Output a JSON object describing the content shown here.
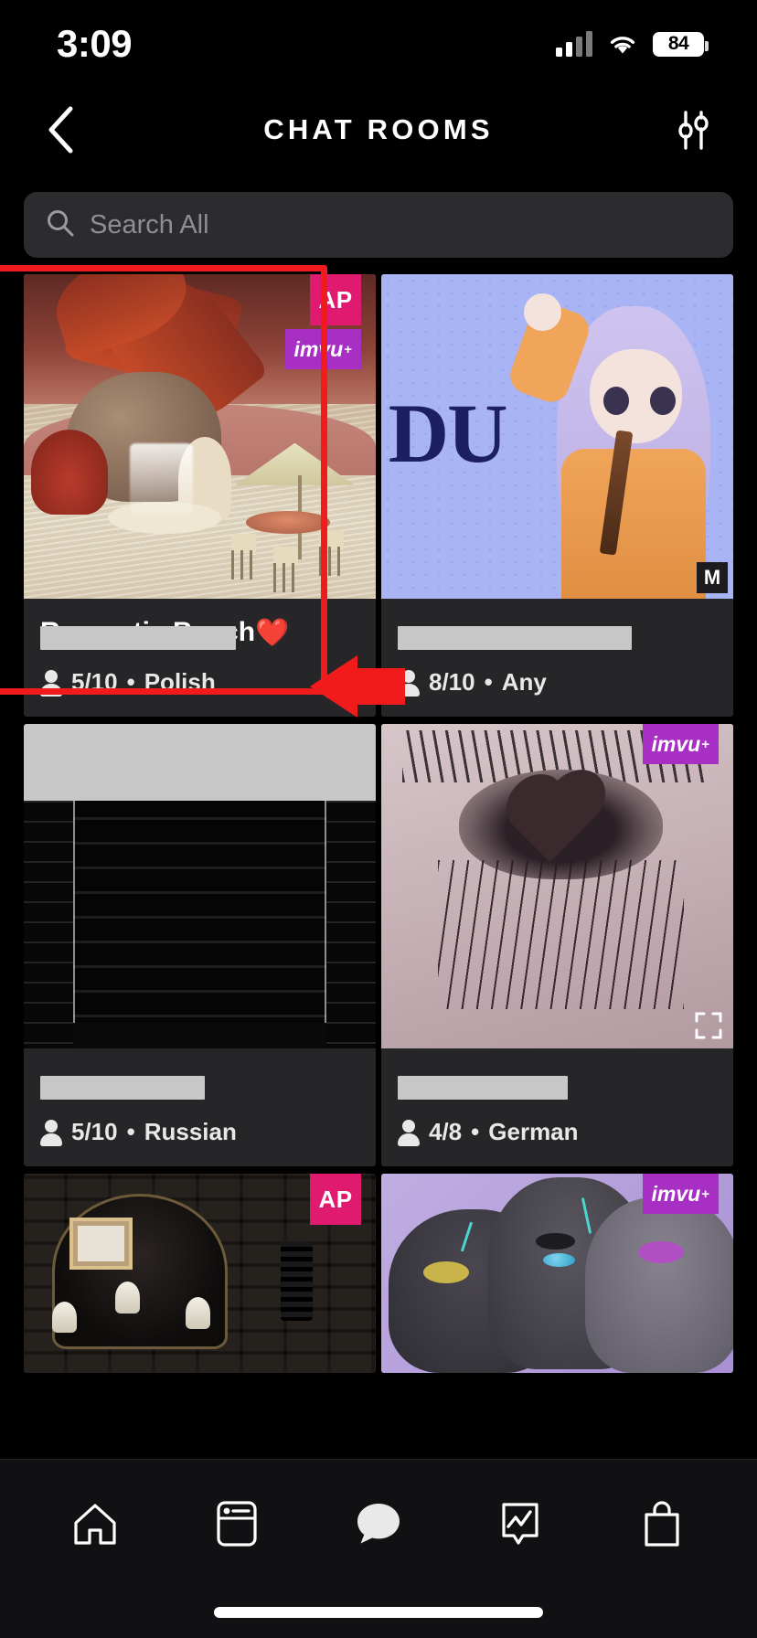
{
  "status_bar": {
    "time": "3:09",
    "battery_percent": "84",
    "wifi_icon": "wifi-icon",
    "signal_icon": "cellular-signal-icon"
  },
  "nav": {
    "back_icon": "chevron-left-icon",
    "title": "CHAT ROOMS",
    "filter_icon": "sliders-filter-icon"
  },
  "search": {
    "placeholder": "Search All",
    "value": "",
    "icon": "search-icon"
  },
  "rooms": [
    {
      "title": "Romantic Beach",
      "title_emoji": "❤️",
      "title_redacted": true,
      "occupancy": "5/10",
      "separator": "•",
      "language": "Polish",
      "badges": [
        "AP",
        "imvu+"
      ],
      "thumb": "beach-oasis-scene",
      "highlighted": true
    },
    {
      "title": "",
      "title_emoji": "",
      "title_redacted": true,
      "occupancy": "8/10",
      "separator": "•",
      "language": "Any",
      "badges": [
        "M"
      ],
      "thumb": "anime-girl-blue-scene",
      "highlighted": false
    },
    {
      "title": "",
      "title_emoji": "",
      "title_redacted": true,
      "occupancy": "5/10",
      "separator": "•",
      "language": "Russian",
      "badges": [],
      "thumb": "dark-shelves-room",
      "highlighted": false
    },
    {
      "title": "",
      "title_emoji": "",
      "title_redacted": true,
      "occupancy": "4/8",
      "separator": "•",
      "language": "German",
      "badges": [
        "imvu+"
      ],
      "thumb": "closeup-eye-photo",
      "highlighted": false
    },
    {
      "title": "",
      "title_emoji": "",
      "title_redacted": false,
      "occupancy": "",
      "separator": "",
      "language": "",
      "badges": [
        "AP"
      ],
      "thumb": "dark-candle-lounge",
      "highlighted": false
    },
    {
      "title": "",
      "title_emoji": "",
      "title_redacted": false,
      "occupancy": "",
      "separator": "",
      "language": "",
      "badges": [
        "imvu+"
      ],
      "thumb": "furry-characters-art",
      "highlighted": false
    }
  ],
  "annotation": {
    "highlight_color": "#f11b1b",
    "arrow_icon": "left-pointing-arrow",
    "arrow_color": "#f11b1b"
  },
  "tabbar": {
    "items": [
      {
        "name": "home",
        "icon": "home-icon",
        "active": false
      },
      {
        "name": "feed",
        "icon": "feed-card-icon",
        "active": false
      },
      {
        "name": "chat",
        "icon": "chat-bubble-icon",
        "active": true
      },
      {
        "name": "activity",
        "icon": "activity-chart-icon",
        "active": false
      },
      {
        "name": "shop",
        "icon": "shopping-bag-icon",
        "active": false
      }
    ]
  },
  "colors": {
    "background": "#000000",
    "card_background": "#262628",
    "search_background": "#2c2c2e",
    "badge_ap": "#e01a6e",
    "badge_imvu": "#a72fc4",
    "redaction": "#c7c7c7"
  }
}
